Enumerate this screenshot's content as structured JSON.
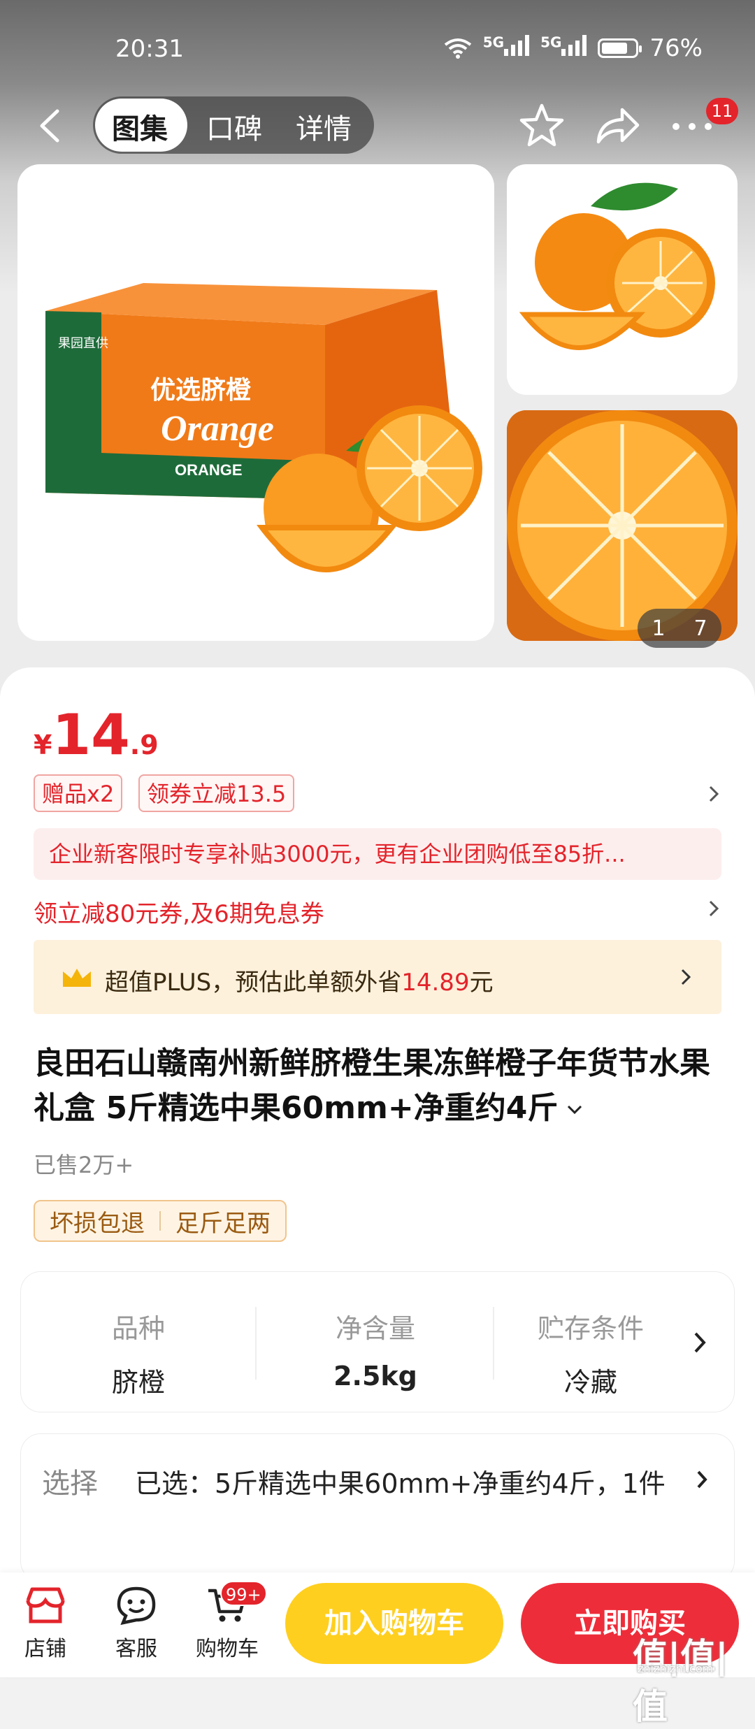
{
  "status_bar": {
    "time": "20:31",
    "battery": "76%",
    "signal1": "5G",
    "signal2": "5G"
  },
  "nav": {
    "tabs": [
      {
        "label": "图集"
      },
      {
        "label": "口碑"
      },
      {
        "label": "详情"
      }
    ],
    "active_tab": "图集",
    "more_badge": "11"
  },
  "gallery": {
    "current": "1",
    "total": "7",
    "box_texts": {
      "brand": "ORANGE",
      "title": "优选脐橙",
      "script": "Orange",
      "side": "果园直供"
    }
  },
  "price": {
    "currency": "¥",
    "integer": "14",
    "decimal": ".9"
  },
  "tags": [
    "赠品x2",
    "领券立减13.5"
  ],
  "promo": "企业新客限时专享补贴3000元，更有企业团购低至85折...",
  "coupon": "领立减80元券,及6期免息券",
  "plus": {
    "text_prefix": "超值PLUS，预估此单额外省",
    "amount": "14.89",
    "unit": "元"
  },
  "title": "良田石山赣南州新鲜脐橙生果冻鲜橙子年货节水果礼盒 5斤精选中果60mm+净重约4斤",
  "sold": "已售2万+",
  "services": [
    "坏损包退",
    "足斤足两"
  ],
  "specs": [
    {
      "key": "品种",
      "value": "脐橙"
    },
    {
      "key": "净含量",
      "value": "2.5kg"
    },
    {
      "key": "贮存条件",
      "value": "冷藏"
    }
  ],
  "selection": {
    "label": "选择",
    "value": "已选：5斤精选中果60mm+净重约4斤，1件"
  },
  "bottom": {
    "shop": "店铺",
    "service": "客服",
    "cart": "购物车",
    "cart_badge": "99+",
    "add_to_cart": "加入购物车",
    "buy_now": "立即购买"
  },
  "watermark": {
    "main": "值|值|值",
    "sub": "zhizhizhi.com"
  },
  "colors": {
    "accent_red": "#e3242b",
    "cart_yellow": "#ffcf1f",
    "plus_bg": "#fdf1dc"
  }
}
